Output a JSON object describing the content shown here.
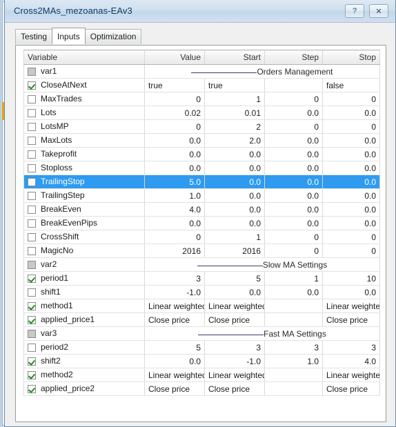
{
  "window": {
    "title": "Cross2MAs_mezoanas-EAv3",
    "help_button": "?",
    "close_button": "✕"
  },
  "tabs": [
    {
      "label": "Testing",
      "selected": false
    },
    {
      "label": "Inputs",
      "selected": true
    },
    {
      "label": "Optimization",
      "selected": false
    }
  ],
  "table": {
    "columns": [
      "Variable",
      "Value",
      "Start",
      "Step",
      "Stop"
    ],
    "rows": [
      {
        "variable": "var1",
        "checkbox": "disabled",
        "type": "section",
        "section": "Orders Management"
      },
      {
        "variable": "CloseAtNext",
        "checkbox": "checked",
        "type": "text",
        "value": "true",
        "start": "true",
        "step": "",
        "stop": "false"
      },
      {
        "variable": "MaxTrades",
        "checkbox": "unchecked",
        "type": "num",
        "value": "0",
        "start": "1",
        "step": "0",
        "stop": "0"
      },
      {
        "variable": "Lots",
        "checkbox": "unchecked",
        "type": "num",
        "value": "0.02",
        "start": "0.01",
        "step": "0.0",
        "stop": "0.0"
      },
      {
        "variable": "LotsMP",
        "checkbox": "unchecked",
        "type": "num",
        "value": "0",
        "start": "2",
        "step": "0",
        "stop": "0"
      },
      {
        "variable": "MaxLots",
        "checkbox": "unchecked",
        "type": "num",
        "value": "0.0",
        "start": "2.0",
        "step": "0.0",
        "stop": "0.0"
      },
      {
        "variable": "Takeprofit",
        "checkbox": "unchecked",
        "type": "num",
        "value": "0.0",
        "start": "0.0",
        "step": "0.0",
        "stop": "0.0"
      },
      {
        "variable": "Stoploss",
        "checkbox": "unchecked",
        "type": "num",
        "value": "0.0",
        "start": "0.0",
        "step": "0.0",
        "stop": "0.0"
      },
      {
        "variable": "TrailingStop",
        "checkbox": "unchecked",
        "type": "num",
        "value": "5.0",
        "start": "0.0",
        "step": "0.0",
        "stop": "0.0",
        "selected": true
      },
      {
        "variable": "TrailingStep",
        "checkbox": "unchecked",
        "type": "num",
        "value": "1.0",
        "start": "0.0",
        "step": "0.0",
        "stop": "0.0"
      },
      {
        "variable": "BreakEven",
        "checkbox": "unchecked",
        "type": "num",
        "value": "4.0",
        "start": "0.0",
        "step": "0.0",
        "stop": "0.0"
      },
      {
        "variable": "BreakEvenPips",
        "checkbox": "unchecked",
        "type": "num",
        "value": "0.0",
        "start": "0.0",
        "step": "0.0",
        "stop": "0.0"
      },
      {
        "variable": "CrossShift",
        "checkbox": "unchecked",
        "type": "num",
        "value": "0",
        "start": "1",
        "step": "0",
        "stop": "0"
      },
      {
        "variable": "MagicNo",
        "checkbox": "unchecked",
        "type": "num",
        "value": "2016",
        "start": "2016",
        "step": "0",
        "stop": "0"
      },
      {
        "variable": "var2",
        "checkbox": "disabled",
        "type": "section",
        "section": "Slow MA Settings"
      },
      {
        "variable": "period1",
        "checkbox": "checked",
        "type": "num",
        "value": "3",
        "start": "5",
        "step": "1",
        "stop": "10"
      },
      {
        "variable": "shift1",
        "checkbox": "unchecked",
        "type": "num",
        "value": "-1.0",
        "start": "0.0",
        "step": "0.0",
        "stop": "0.0"
      },
      {
        "variable": "method1",
        "checkbox": "checked",
        "type": "text",
        "value": "Linear weighted",
        "start": "Linear weighted",
        "step": "",
        "stop": "Linear weighted"
      },
      {
        "variable": "applied_price1",
        "checkbox": "checked",
        "type": "text",
        "value": "Close price",
        "start": "Close price",
        "step": "",
        "stop": "Close price"
      },
      {
        "variable": "var3",
        "checkbox": "disabled",
        "type": "section",
        "section": "Fast MA Settings"
      },
      {
        "variable": "period2",
        "checkbox": "unchecked",
        "type": "num",
        "value": "5",
        "start": "3",
        "step": "3",
        "stop": "3"
      },
      {
        "variable": "shift2",
        "checkbox": "checked",
        "type": "num",
        "value": "0.0",
        "start": "-1.0",
        "step": "1.0",
        "stop": "4.0"
      },
      {
        "variable": "method2",
        "checkbox": "checked",
        "type": "text",
        "value": "Linear weighted",
        "start": "Linear weighted",
        "step": "",
        "stop": "Linear weighted"
      },
      {
        "variable": "applied_price2",
        "checkbox": "checked",
        "type": "text",
        "value": "Close price",
        "start": "Close price",
        "step": "",
        "stop": "Close price"
      }
    ]
  },
  "colors": {
    "selection": "#2e9bf0",
    "checkmark": "#1a8f1a",
    "title_text": "#113c63",
    "alt_row": "#ebebeb"
  }
}
